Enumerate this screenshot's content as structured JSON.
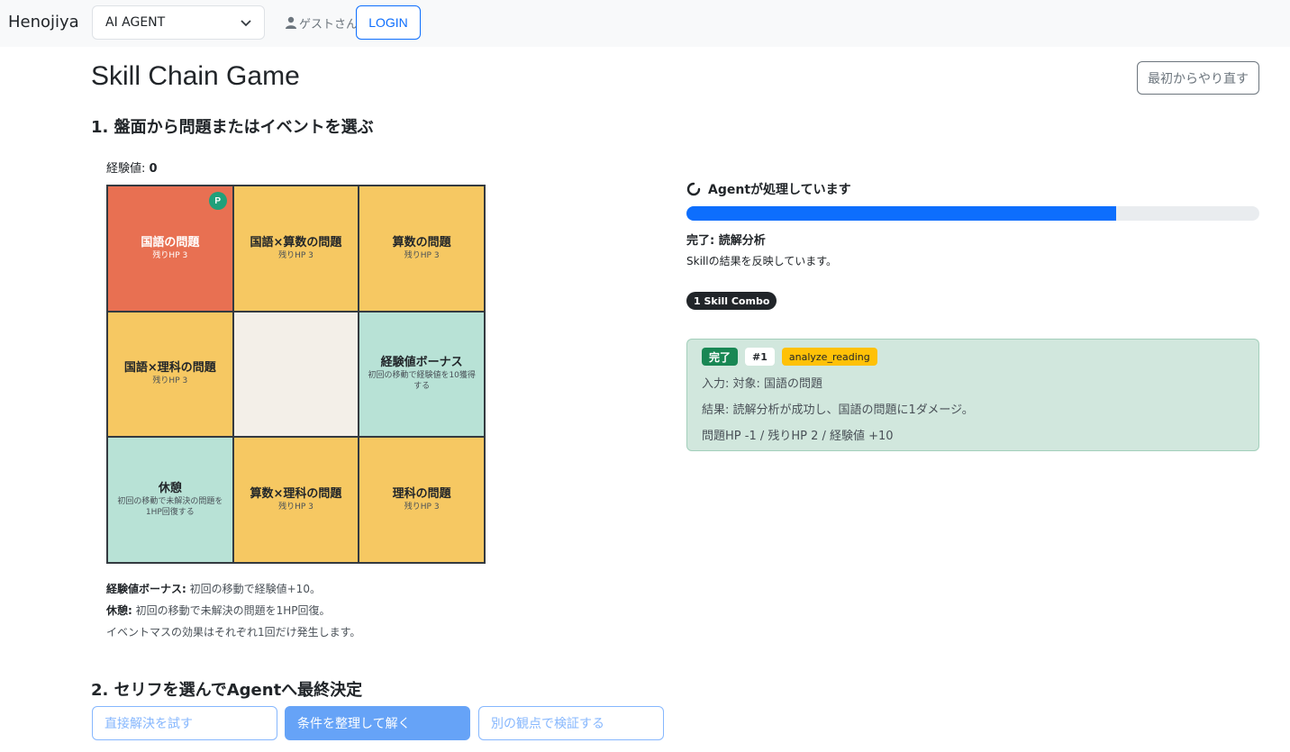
{
  "navbar": {
    "brand": "Henojiya",
    "agent_select": {
      "value": "AI AGENT"
    },
    "user_label": "ゲストさん",
    "login_label": "LOGIN"
  },
  "page": {
    "title": "Skill Chain Game",
    "restart_label": "最初からやり直す"
  },
  "section1": {
    "title": "1. 盤面から問題またはイベントを選ぶ",
    "exp_label": "経験値:",
    "exp_value": "0"
  },
  "board": {
    "player_marker": "P",
    "cells": [
      {
        "kind": "current",
        "title": "国語の問題",
        "sub": "残りHP 3"
      },
      {
        "kind": "problem",
        "title": "国語×算数の問題",
        "sub": "残りHP 3"
      },
      {
        "kind": "problem",
        "title": "算数の問題",
        "sub": "残りHP 3"
      },
      {
        "kind": "problem",
        "title": "国語×理科の問題",
        "sub": "残りHP 3"
      },
      {
        "kind": "empty",
        "title": "",
        "sub": ""
      },
      {
        "kind": "event",
        "title": "経験値ボーナス",
        "sub": "初回の移動で経験値を10獲得する"
      },
      {
        "kind": "event",
        "title": "休憩",
        "sub": "初回の移動で未解決の問題を1HP回復する"
      },
      {
        "kind": "problem",
        "title": "算数×理科の問題",
        "sub": "残りHP 3"
      },
      {
        "kind": "problem",
        "title": "理科の問題",
        "sub": "残りHP 3"
      }
    ]
  },
  "legend": {
    "bonus_label": "経験値ボーナス:",
    "bonus_text": " 初回の移動で経験値+10。",
    "rest_label": "休憩:",
    "rest_text": " 初回の移動で未解決の問題を1HP回復。",
    "note": "イベントマスの効果はそれぞれ1回だけ発生します。"
  },
  "section2": {
    "title": "2. セリフを選んでAgentへ最終決定",
    "choices": [
      {
        "label": "直接解決を試す",
        "active": false
      },
      {
        "label": "条件を整理して解く",
        "active": true
      },
      {
        "label": "別の観点で検証する",
        "active": false
      }
    ]
  },
  "status": {
    "heading": "Agentが処理しています",
    "progress": 0.75,
    "done_label": "完了: 読解分析",
    "done_desc": "Skillの結果を反映しています。",
    "combo": "1 Skill Combo"
  },
  "result_card": {
    "status_badge": "完了",
    "index_badge": "#1",
    "skill_badge": "analyze_reading",
    "input_line": "入力: 対象: 国語の問題",
    "result_line": "結果: 読解分析が成功し、国語の問題に1ダメージ。",
    "stats_line": "問題HP -1 / 残りHP 2 / 経験値 +10"
  },
  "colors": {
    "primary": "#0d6efd",
    "current_cell": "#e87052",
    "problem_cell": "#f6c862",
    "event_cell": "#b8e2d6",
    "success": "#198754",
    "warning": "#ffc107"
  },
  "icons": {
    "user": "user-icon",
    "select_chevron": "chevron-down-icon",
    "spinner": "spinner-icon"
  }
}
